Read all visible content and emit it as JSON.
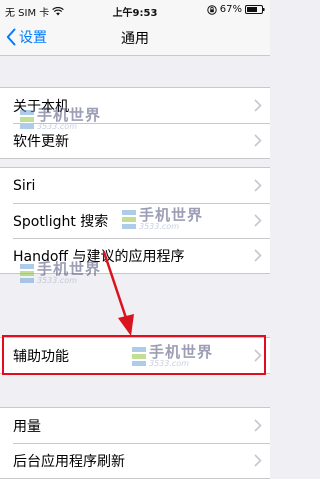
{
  "status_bar": {
    "carrier": "无 SIM 卡",
    "time": "上午9:53",
    "battery_percent": "67%"
  },
  "nav": {
    "back_label": "设置",
    "title": "通用"
  },
  "groups": [
    {
      "items": [
        "关于本机",
        "软件更新"
      ]
    },
    {
      "items": [
        "Siri",
        "Spotlight 搜索",
        "Handoff 与建议的应用程序"
      ]
    },
    {
      "items": [
        "辅助功能"
      ]
    },
    {
      "items": [
        "用量",
        "后台应用程序刷新"
      ]
    }
  ],
  "highlighted_item": "辅助功能",
  "watermark": {
    "text": "手机世界",
    "sub": "3533.com"
  },
  "colors": {
    "accent": "#007aff",
    "highlight": "#e30b1e",
    "background": "#efeff4"
  }
}
